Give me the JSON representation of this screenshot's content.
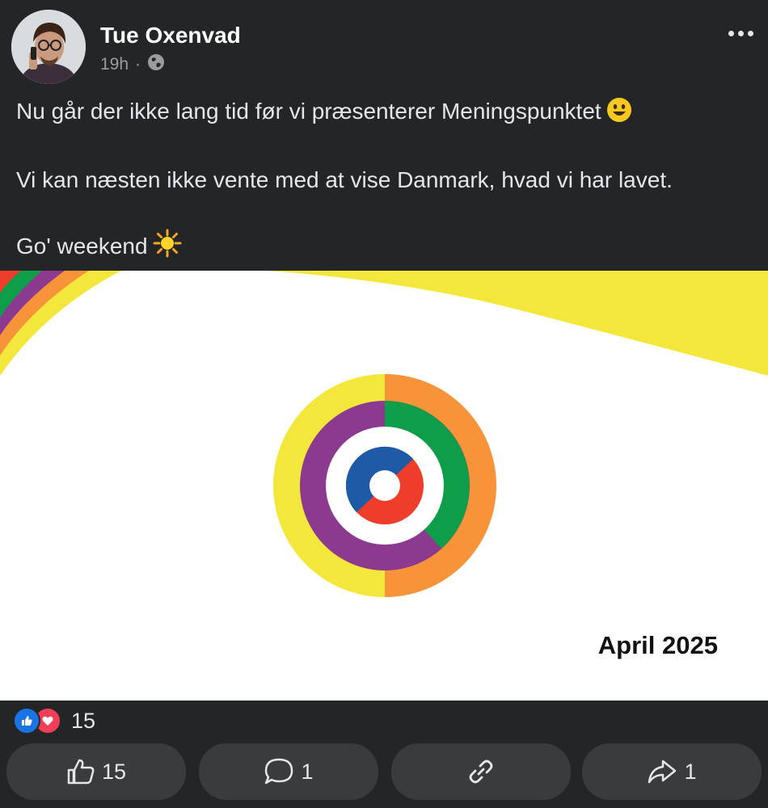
{
  "post": {
    "author": "Tue Oxenvad",
    "time": "19h",
    "separator": "·",
    "privacy_icon": "globe-icon",
    "more_icon": "more-dots-icon",
    "text": {
      "line1": "Nu går der ikke lang tid før vi præsenterer Meningspunktet",
      "line1_emoji": "😀",
      "line2": "Vi kan næsten ikke vente med at vise Danmark, hvad vi har lavet.",
      "line3": "Go' weekend",
      "line3_emoji": "☀️"
    }
  },
  "banner": {
    "date_label": "April 2025",
    "colors": {
      "yellow": "#f4e73b",
      "orange": "#f7943a",
      "green": "#0e9e4a",
      "purple": "#8b3a8f",
      "blue": "#1f5aa6",
      "red": "#ee3d2a"
    }
  },
  "reactions": {
    "icons": [
      "like-reaction-icon",
      "love-reaction-icon"
    ],
    "count": "15"
  },
  "actions": {
    "like": {
      "icon": "thumbs-up-icon",
      "count": "15"
    },
    "comment": {
      "icon": "comment-bubble-icon",
      "count": "1"
    },
    "copy_link": {
      "icon": "link-icon"
    },
    "share": {
      "icon": "share-arrow-icon",
      "count": "1"
    }
  },
  "colors": {
    "background": "#242526",
    "button": "#3a3b3c",
    "text": "#e4e6eb",
    "meta_text": "#9a9ca0",
    "like_blue": "#1b74e4",
    "love_red": "#f33e58"
  }
}
